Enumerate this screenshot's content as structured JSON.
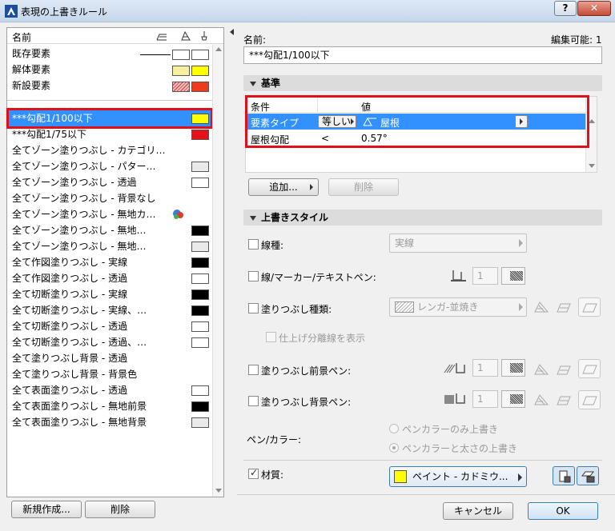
{
  "window": {
    "title": "表現の上書きルール",
    "help_label": "?",
    "close_label": "✕"
  },
  "left": {
    "header": {
      "name_col": "名前"
    },
    "system_rows": [
      {
        "label": "既存要素",
        "color1": "#ffffff",
        "color2": "#ffffff"
      },
      {
        "label": "解体要素",
        "color1": "#f5f0a0",
        "color2": "#ffff00"
      },
      {
        "label": "新設要素",
        "color1": "#f0c0c0",
        "color2": "#ee3b1f"
      }
    ],
    "rules": [
      {
        "label": "***勾配1/100以下",
        "color": "#ffff00"
      },
      {
        "label": "***勾配1/75以下",
        "color": "#e8101a"
      },
      {
        "label": "全てゾーン塗りつぶし - カテゴリ…",
        "color": null
      },
      {
        "label": "全てゾーン塗りつぶし - パター…",
        "color": "#eaeaea"
      },
      {
        "label": "全てゾーン塗りつぶし - 透過",
        "color": "#ffffff"
      },
      {
        "label": "全てゾーン塗りつぶし - 背景なし",
        "color": null
      },
      {
        "label": "全てゾーン塗りつぶし - 無地カ…",
        "color": null
      },
      {
        "label": "全てゾーン塗りつぶし - 無地…",
        "color": "#000000"
      },
      {
        "label": "全てゾーン塗りつぶし - 無地…",
        "color": "#eaeaea"
      },
      {
        "label": "全て作図塗りつぶし - 実線",
        "color": "#000000"
      },
      {
        "label": "全て作図塗りつぶし - 透過",
        "color": "#ffffff"
      },
      {
        "label": "全て切断塗りつぶし - 実線",
        "color": "#000000"
      },
      {
        "label": "全て切断塗りつぶし - 実線、…",
        "color": "#000000"
      },
      {
        "label": "全て切断塗りつぶし - 透過",
        "color": "#ffffff"
      },
      {
        "label": "全て切断塗りつぶし - 透過、…",
        "color": "#ffffff"
      },
      {
        "label": "全て塗りつぶし背景 - 透過",
        "color": null
      },
      {
        "label": "全て塗りつぶし背景 - 背景色",
        "color": null
      },
      {
        "label": "全て表面塗りつぶし - 透過",
        "color": "#ffffff"
      },
      {
        "label": "全て表面塗りつぶし - 無地前景",
        "color": "#000000"
      },
      {
        "label": "全て表面塗りつぶし - 無地背景",
        "color": "#eaeaea"
      }
    ],
    "new_button": "新規作成...",
    "delete_button": "削除"
  },
  "right": {
    "name_label": "名前:",
    "editable_label": "編集可能: 1",
    "name_value": "***勾配1/100以下",
    "criteria": {
      "section_title": "基準",
      "col_condition": "条件",
      "col_value": "値",
      "rows": [
        {
          "condition": "要素タイプ",
          "operator": "等しい",
          "value": "屋根"
        },
        {
          "condition": "屋根勾配",
          "operator": "<",
          "value": "0.57°"
        }
      ],
      "add_button": "追加...",
      "delete_button": "削除"
    },
    "style": {
      "section_title": "上書きスタイル",
      "line_type_label": "線種:",
      "line_type_value": "実線",
      "pen_label": "線/マーカー/テキストペン:",
      "pen_value": "1",
      "fill_type_label": "塗りつぶし種類:",
      "fill_type_value": "レンガ-並焼き",
      "show_sep_label": "仕上げ分離線を表示",
      "fill_fg_label": "塗りつぶし前景ペン:",
      "fill_fg_value": "1",
      "fill_bg_label": "塗りつぶし背景ペン:",
      "fill_bg_value": "1",
      "pen_color_label": "ペン/カラー:",
      "radio1": "ペンカラーのみ上書き",
      "radio2": "ペンカラーと太さの上書き",
      "material_label": "材質:",
      "material_value": "ペイント - カドミウ..."
    },
    "cancel_button": "キャンセル",
    "ok_button": "OK"
  }
}
